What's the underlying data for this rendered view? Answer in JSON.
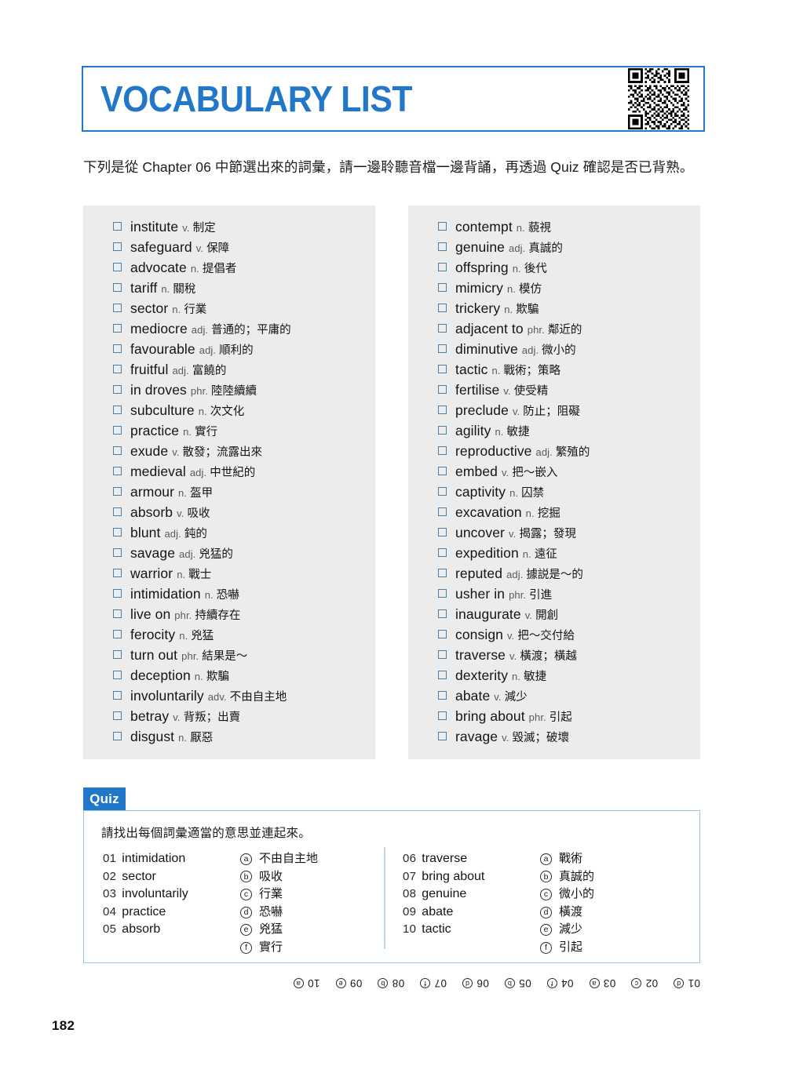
{
  "header": {
    "title": "VOCABULARY LIST",
    "qr_icon": "qr-code-icon",
    "accent_color": "#2277C8"
  },
  "intro": {
    "text": "下列是從 Chapter 06 中節選出來的詞彙，請一邊聆聽音檔一邊背誦，再透過 Quiz 確認是否已背熟。"
  },
  "vocabulary": {
    "checkbox_icon": "checkbox-empty-icon",
    "box_background": "#ECECEC",
    "left_column": [
      {
        "word": "institute",
        "pos": "v.",
        "definition": "制定"
      },
      {
        "word": "safeguard",
        "pos": "v.",
        "definition": "保障"
      },
      {
        "word": "advocate",
        "pos": "n.",
        "definition": "提倡者"
      },
      {
        "word": "tariff",
        "pos": "n.",
        "definition": "關稅"
      },
      {
        "word": "sector",
        "pos": "n.",
        "definition": "行業"
      },
      {
        "word": "mediocre",
        "pos": "adj.",
        "definition": "普通的；平庸的"
      },
      {
        "word": "favourable",
        "pos": "adj.",
        "definition": "順利的"
      },
      {
        "word": "fruitful",
        "pos": "adj.",
        "definition": "富饒的"
      },
      {
        "word": "in droves",
        "pos": "phr.",
        "definition": "陸陸續續"
      },
      {
        "word": "subculture",
        "pos": "n.",
        "definition": "次文化"
      },
      {
        "word": "practice",
        "pos": "n.",
        "definition": "實行"
      },
      {
        "word": "exude",
        "pos": "v.",
        "definition": "散發；流露出來"
      },
      {
        "word": "medieval",
        "pos": "adj.",
        "definition": "中世紀的"
      },
      {
        "word": "armour",
        "pos": "n.",
        "definition": "盔甲"
      },
      {
        "word": "absorb",
        "pos": "v.",
        "definition": "吸收"
      },
      {
        "word": "blunt",
        "pos": "adj.",
        "definition": "鈍的"
      },
      {
        "word": "savage",
        "pos": "adj.",
        "definition": "兇猛的"
      },
      {
        "word": "warrior",
        "pos": "n.",
        "definition": "戰士"
      },
      {
        "word": "intimidation",
        "pos": "n.",
        "definition": "恐嚇"
      },
      {
        "word": "live on",
        "pos": "phr.",
        "definition": "持續存在"
      },
      {
        "word": "ferocity",
        "pos": "n.",
        "definition": "兇猛"
      },
      {
        "word": "turn out",
        "pos": "phr.",
        "definition": "結果是～"
      },
      {
        "word": "deception",
        "pos": "n.",
        "definition": "欺騙"
      },
      {
        "word": "involuntarily",
        "pos": "adv.",
        "definition": "不由自主地"
      },
      {
        "word": "betray",
        "pos": "v.",
        "definition": "背叛；出賣"
      },
      {
        "word": "disgust",
        "pos": "n.",
        "definition": "厭惡"
      }
    ],
    "right_column": [
      {
        "word": "contempt",
        "pos": "n.",
        "definition": "藐視"
      },
      {
        "word": "genuine",
        "pos": "adj.",
        "definition": "真誠的"
      },
      {
        "word": "offspring",
        "pos": "n.",
        "definition": "後代"
      },
      {
        "word": "mimicry",
        "pos": "n.",
        "definition": "模仿"
      },
      {
        "word": "trickery",
        "pos": "n.",
        "definition": "欺騙"
      },
      {
        "word": "adjacent to",
        "pos": "phr.",
        "definition": "鄰近的"
      },
      {
        "word": "diminutive",
        "pos": "adj.",
        "definition": "微小的"
      },
      {
        "word": "tactic",
        "pos": "n.",
        "definition": "戰術；策略"
      },
      {
        "word": "fertilise",
        "pos": "v.",
        "definition": "使受精"
      },
      {
        "word": "preclude",
        "pos": "v.",
        "definition": "防止；阻礙"
      },
      {
        "word": "agility",
        "pos": "n.",
        "definition": "敏捷"
      },
      {
        "word": "reproductive",
        "pos": "adj.",
        "definition": "繁殖的"
      },
      {
        "word": "embed",
        "pos": "v.",
        "definition": "把～嵌入"
      },
      {
        "word": "captivity",
        "pos": "n.",
        "definition": "囚禁"
      },
      {
        "word": "excavation",
        "pos": "n.",
        "definition": "挖掘"
      },
      {
        "word": "uncover",
        "pos": "v.",
        "definition": "揭露；發現"
      },
      {
        "word": "expedition",
        "pos": "n.",
        "definition": "遠征"
      },
      {
        "word": "reputed",
        "pos": "adj.",
        "definition": "據説是～的"
      },
      {
        "word": "usher in",
        "pos": "phr.",
        "definition": "引進"
      },
      {
        "word": "inaugurate",
        "pos": "v.",
        "definition": "開創"
      },
      {
        "word": "consign",
        "pos": "v.",
        "definition": "把～交付給"
      },
      {
        "word": "traverse",
        "pos": "v.",
        "definition": "橫渡；橫越"
      },
      {
        "word": "dexterity",
        "pos": "n.",
        "definition": "敏捷"
      },
      {
        "word": "abate",
        "pos": "v.",
        "definition": "減少"
      },
      {
        "word": "bring about",
        "pos": "phr.",
        "definition": "引起"
      },
      {
        "word": "ravage",
        "pos": "v.",
        "definition": "毀滅；破壞"
      }
    ]
  },
  "quiz": {
    "badge_label": "Quiz",
    "instruction": "請找出每個詞彙適當的意思並連起來。",
    "group_one": {
      "terms": [
        {
          "num": "01",
          "term": "intimidation"
        },
        {
          "num": "02",
          "term": "sector"
        },
        {
          "num": "03",
          "term": "involuntarily"
        },
        {
          "num": "04",
          "term": "practice"
        },
        {
          "num": "05",
          "term": "absorb"
        }
      ],
      "choices": [
        {
          "mark": "a",
          "text": "不由自主地"
        },
        {
          "mark": "b",
          "text": "吸收"
        },
        {
          "mark": "c",
          "text": "行業"
        },
        {
          "mark": "d",
          "text": "恐嚇"
        },
        {
          "mark": "e",
          "text": "兇猛"
        },
        {
          "mark": "f",
          "text": "實行"
        }
      ]
    },
    "group_two": {
      "terms": [
        {
          "num": "06",
          "term": "traverse"
        },
        {
          "num": "07",
          "term": "bring about"
        },
        {
          "num": "08",
          "term": "genuine"
        },
        {
          "num": "09",
          "term": "abate"
        },
        {
          "num": "10",
          "term": "tactic"
        }
      ],
      "choices": [
        {
          "mark": "a",
          "text": "戰術"
        },
        {
          "mark": "b",
          "text": "真誠的"
        },
        {
          "mark": "c",
          "text": "微小的"
        },
        {
          "mark": "d",
          "text": "橫渡"
        },
        {
          "mark": "e",
          "text": "減少"
        },
        {
          "mark": "f",
          "text": "引起"
        }
      ]
    }
  },
  "answer_key": [
    {
      "num": "01",
      "mark": "d"
    },
    {
      "num": "02",
      "mark": "c"
    },
    {
      "num": "03",
      "mark": "a"
    },
    {
      "num": "04",
      "mark": "f"
    },
    {
      "num": "05",
      "mark": "b"
    },
    {
      "num": "06",
      "mark": "d"
    },
    {
      "num": "07",
      "mark": "f"
    },
    {
      "num": "08",
      "mark": "b"
    },
    {
      "num": "09",
      "mark": "e"
    },
    {
      "num": "10",
      "mark": "a"
    }
  ],
  "footer": {
    "page_number": "182"
  }
}
